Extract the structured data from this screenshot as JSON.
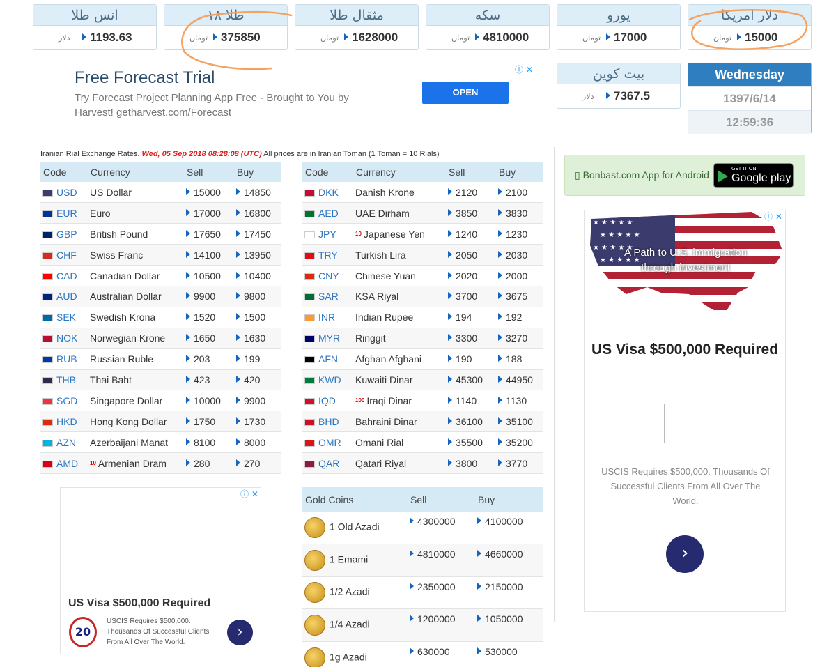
{
  "top_prices": [
    {
      "title": "انس طلا",
      "value": "1193.63",
      "unit": "دلار"
    },
    {
      "title": "طلا ۱۸",
      "value": "375850",
      "unit": "تومان"
    },
    {
      "title": "مثقال طلا",
      "value": "1628000",
      "unit": "تومان"
    },
    {
      "title": "سکه",
      "value": "4810000",
      "unit": "تومان"
    },
    {
      "title": "یورو",
      "value": "17000",
      "unit": "تومان"
    },
    {
      "title": "دلار امریکا",
      "value": "15000",
      "unit": "تومان"
    }
  ],
  "bitcoin": {
    "title": "بیت کوین",
    "value": "7367.5",
    "unit": "دلار"
  },
  "date": {
    "day": "Wednesday",
    "jalali": "1397/6/14",
    "time": "12:59:36"
  },
  "top_ad": {
    "title": "Free Forecast Trial",
    "text": "Try Forecast Project Planning App Free - Brought to You by Harvest! getharvest.com/Forecast",
    "button": "OPEN",
    "choices": "ⓘ ✕"
  },
  "info": {
    "prefix": "Iranian Rial Exchange Rates.",
    "timestamp": "Wed, 05 Sep 2018 08:28:08 (UTC)",
    "suffix": "All prices are in Iranian Toman (1 Toman = 10 Rials)"
  },
  "table_headers": {
    "code": "Code",
    "currency": "Currency",
    "sell": "Sell",
    "buy": "Buy"
  },
  "left_rates": [
    {
      "code": "USD",
      "name": "US Dollar",
      "sell": "15000",
      "buy": "14850",
      "mult": "",
      "flag": "#3c3b6e"
    },
    {
      "code": "EUR",
      "name": "Euro",
      "sell": "17000",
      "buy": "16800",
      "mult": "",
      "flag": "#003399"
    },
    {
      "code": "GBP",
      "name": "British Pound",
      "sell": "17650",
      "buy": "17450",
      "mult": "",
      "flag": "#012169"
    },
    {
      "code": "CHF",
      "name": "Swiss Franc",
      "sell": "14100",
      "buy": "13950",
      "mult": "",
      "flag": "#d52b1e"
    },
    {
      "code": "CAD",
      "name": "Canadian Dollar",
      "sell": "10500",
      "buy": "10400",
      "mult": "",
      "flag": "#ff0000"
    },
    {
      "code": "AUD",
      "name": "Australian Dollar",
      "sell": "9900",
      "buy": "9800",
      "mult": "",
      "flag": "#00247d"
    },
    {
      "code": "SEK",
      "name": "Swedish Krona",
      "sell": "1520",
      "buy": "1500",
      "mult": "",
      "flag": "#006aa7"
    },
    {
      "code": "NOK",
      "name": "Norwegian Krone",
      "sell": "1650",
      "buy": "1630",
      "mult": "",
      "flag": "#ba0c2f"
    },
    {
      "code": "RUB",
      "name": "Russian Ruble",
      "sell": "203",
      "buy": "199",
      "mult": "",
      "flag": "#0039a6"
    },
    {
      "code": "THB",
      "name": "Thai Baht",
      "sell": "423",
      "buy": "420",
      "mult": "",
      "flag": "#2d2a4a"
    },
    {
      "code": "SGD",
      "name": "Singapore Dollar",
      "sell": "10000",
      "buy": "9900",
      "mult": "",
      "flag": "#ef3340"
    },
    {
      "code": "HKD",
      "name": "Hong Kong Dollar",
      "sell": "1750",
      "buy": "1730",
      "mult": "",
      "flag": "#de2910"
    },
    {
      "code": "AZN",
      "name": "Azerbaijani Manat",
      "sell": "8100",
      "buy": "8000",
      "mult": "",
      "flag": "#00b5e2"
    },
    {
      "code": "AMD",
      "name": "Armenian Dram",
      "sell": "280",
      "buy": "270",
      "mult": "10",
      "flag": "#d90012"
    }
  ],
  "right_rates": [
    {
      "code": "DKK",
      "name": "Danish Krone",
      "sell": "2120",
      "buy": "2100",
      "mult": "",
      "flag": "#c60c30"
    },
    {
      "code": "AED",
      "name": "UAE Dirham",
      "sell": "3850",
      "buy": "3830",
      "mult": "",
      "flag": "#00732f"
    },
    {
      "code": "JPY",
      "name": "Japanese Yen",
      "sell": "1240",
      "buy": "1230",
      "mult": "10",
      "flag": "#ffffff"
    },
    {
      "code": "TRY",
      "name": "Turkish Lira",
      "sell": "2050",
      "buy": "2030",
      "mult": "",
      "flag": "#e30a17"
    },
    {
      "code": "CNY",
      "name": "Chinese Yuan",
      "sell": "2020",
      "buy": "2000",
      "mult": "",
      "flag": "#de2910"
    },
    {
      "code": "SAR",
      "name": "KSA Riyal",
      "sell": "3700",
      "buy": "3675",
      "mult": "",
      "flag": "#006c35"
    },
    {
      "code": "INR",
      "name": "Indian Rupee",
      "sell": "194",
      "buy": "192",
      "mult": "",
      "flag": "#ff9933"
    },
    {
      "code": "MYR",
      "name": "Ringgit",
      "sell": "3300",
      "buy": "3270",
      "mult": "",
      "flag": "#010066"
    },
    {
      "code": "AFN",
      "name": "Afghan Afghani",
      "sell": "190",
      "buy": "188",
      "mult": "",
      "flag": "#000000"
    },
    {
      "code": "KWD",
      "name": "Kuwaiti Dinar",
      "sell": "45300",
      "buy": "44950",
      "mult": "",
      "flag": "#007a3d"
    },
    {
      "code": "IQD",
      "name": "Iraqi Dinar",
      "sell": "1140",
      "buy": "1130",
      "mult": "100",
      "flag": "#ce1126"
    },
    {
      "code": "BHD",
      "name": "Bahraini Dinar",
      "sell": "36100",
      "buy": "35100",
      "mult": "",
      "flag": "#ce1126"
    },
    {
      "code": "OMR",
      "name": "Omani Rial",
      "sell": "35500",
      "buy": "35200",
      "mult": "",
      "flag": "#db161b"
    },
    {
      "code": "QAR",
      "name": "Qatari Riyal",
      "sell": "3800",
      "buy": "3770",
      "mult": "",
      "flag": "#8d1b3d"
    }
  ],
  "gold_headers": {
    "name": "Gold Coins",
    "sell": "Sell",
    "buy": "Buy"
  },
  "gold_coins": [
    {
      "name": "1 Old Azadi",
      "sell": "4300000",
      "buy": "4100000"
    },
    {
      "name": "1 Emami",
      "sell": "4810000",
      "buy": "4660000"
    },
    {
      "name": "1/2 Azadi",
      "sell": "2350000",
      "buy": "2150000"
    },
    {
      "name": "1/4 Azadi",
      "sell": "1200000",
      "buy": "1050000"
    },
    {
      "name": "1g Azadi",
      "sell": "630000",
      "buy": "530000"
    }
  ],
  "app_banner": {
    "text": "Bonbast.com App for Android",
    "store_small": "GET IT ON",
    "store_big": "Google play"
  },
  "side_ad": {
    "banner": "A Path to U.S. immigration through investment",
    "title": "US Visa $500,000 Required",
    "text": "USCIS Requires $500,000. Thousands Of Successful Clients From All Over The World.",
    "choices": "ⓘ ✕"
  },
  "bottom_ad": {
    "title": "US Visa $500,000 Required",
    "text": "USCIS Requires $500,000. Thousands Of Successful Clients From All Over The World.",
    "logo": "20",
    "choices": "ⓘ ✕"
  },
  "colors": {
    "header_bg": "#ddeef8",
    "accent": "#1565c0",
    "annotation": "#f4a261"
  }
}
